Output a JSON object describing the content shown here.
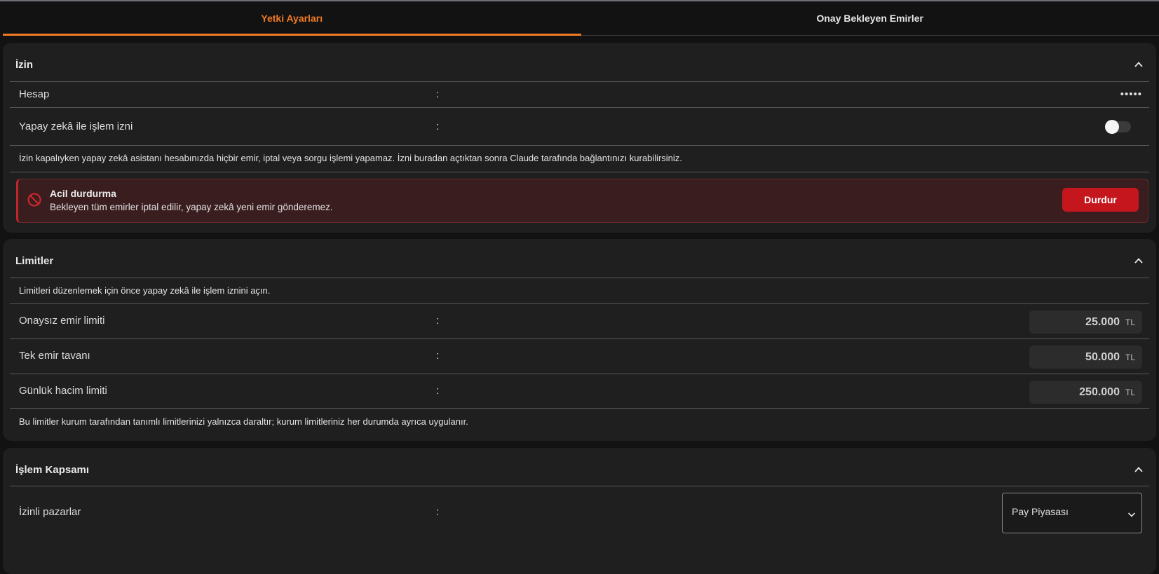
{
  "tabs": [
    {
      "label": "Yetki Ayarları",
      "active": true
    },
    {
      "label": "Onay Bekleyen Emirler",
      "active": false
    }
  ],
  "izin": {
    "title": "İzin",
    "account_label": "Hesap",
    "account_value": "•••••",
    "ai_label": "Yapay zekâ ile işlem izni",
    "ai_enabled": false,
    "colon": ":",
    "note": "İzin kapalıyken yapay zekâ asistanı hesabınızda hiçbir emir, iptal veya sorgu işlemi yapamaz. İzni buradan açtıktan sonra Claude tarafında bağlantınızı kurabilirsiniz.",
    "alert": {
      "title": "Acil durdurma",
      "description": "Bekleyen tüm emirler iptal edilir, yapay zekâ yeni emir gönderemez.",
      "button": "Durdur",
      "icon": "prohibited-icon",
      "color": "#c4161c"
    }
  },
  "limits": {
    "title": "Limitler",
    "top_note": "Limitleri düzenlemek için önce yapay zekâ ile işlem iznini açın.",
    "rows": [
      {
        "label": "Onaysız emir limiti",
        "value": "25.000",
        "unit": "TL"
      },
      {
        "label": "Tek emir tavanı",
        "value": "50.000",
        "unit": "TL"
      },
      {
        "label": "Günlük hacim limiti",
        "value": "250.000",
        "unit": "TL"
      }
    ],
    "bottom_note": "Bu limitler kurum tarafından tanımlı limitlerinizi yalnızca daraltır; kurum limitleriniz her durumda ayrıca uygulanır."
  },
  "scope": {
    "title": "İşlem Kapsamı",
    "markets_label": "İzinli pazarlar",
    "markets_value": "Pay Piyasası"
  },
  "colors": {
    "accent": "#f07a25",
    "danger": "#c4161c",
    "background": "#121212",
    "card": "#1f1f1f"
  }
}
